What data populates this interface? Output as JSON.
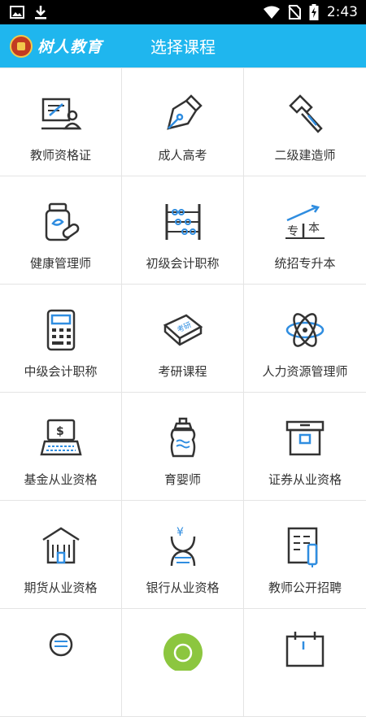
{
  "status_bar": {
    "time": "2:43",
    "icons": [
      "image-icon",
      "download-icon",
      "wifi-icon",
      "no-sim-icon",
      "battery-icon"
    ]
  },
  "header": {
    "logo_text": "树人教育",
    "title": "选择课程"
  },
  "colors": {
    "header_bg": "#1fb6ee",
    "icon_stroke": "#333333",
    "icon_accent": "#2f8de0"
  },
  "courses": [
    {
      "label": "教师资格证",
      "icon": "teacher-board-icon"
    },
    {
      "label": "成人高考",
      "icon": "pen-nib-icon"
    },
    {
      "label": "二级建造师",
      "icon": "hammer-icon"
    },
    {
      "label": "健康管理师",
      "icon": "medicine-bottle-icon"
    },
    {
      "label": "初级会计职称",
      "icon": "abacus-icon"
    },
    {
      "label": "统招专升本",
      "icon": "upgrade-chart-icon"
    },
    {
      "label": "中级会计职称",
      "icon": "calculator-icon"
    },
    {
      "label": "考研课程",
      "icon": "exam-book-icon"
    },
    {
      "label": "人力资源管理师",
      "icon": "atom-icon"
    },
    {
      "label": "基金从业资格",
      "icon": "fund-laptop-icon"
    },
    {
      "label": "育婴师",
      "icon": "baby-bottle-icon"
    },
    {
      "label": "证券从业资格",
      "icon": "securities-box-icon"
    },
    {
      "label": "期货从业资格",
      "icon": "bank-building-icon"
    },
    {
      "label": "银行从业资格",
      "icon": "dna-yuan-icon"
    },
    {
      "label": "教师公开招聘",
      "icon": "recruitment-doc-icon"
    },
    {
      "label": "",
      "icon": "coin-stack-icon"
    },
    {
      "label": "",
      "icon": "green-badge-icon"
    },
    {
      "label": "",
      "icon": "calendar-icon"
    }
  ]
}
